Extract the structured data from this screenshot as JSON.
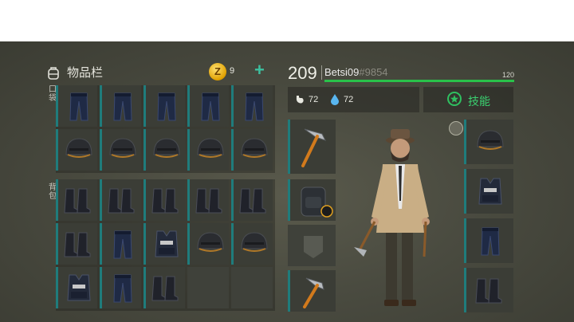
{
  "inventory": {
    "title": "物品栏",
    "coins": "9",
    "add": "+"
  },
  "sections": {
    "pockets": "口袋",
    "backpack": "背包"
  },
  "player": {
    "level": "209",
    "name": "Betsi09",
    "tag": "#9854",
    "xp_max": "120",
    "xp_fraction": 1.0
  },
  "stats": {
    "hunger": "72",
    "thirst": "72"
  },
  "skills": {
    "label": "技能"
  },
  "pocket_slots": [
    "police-pants",
    "police-pants",
    "police-pants",
    "police-pants",
    "police-pants",
    "police-helmet",
    "police-helmet",
    "police-helmet",
    "police-helmet",
    "police-helmet"
  ],
  "backpack_slots": [
    "police-boots",
    "police-boots",
    "police-boots",
    "police-boots",
    "police-boots",
    "police-boots",
    "police-pants",
    "police-vest",
    "police-helmet",
    "police-helmet",
    "police-vest",
    "police-pants",
    "police-boots",
    "",
    ""
  ],
  "equipment": {
    "weapon": "pickaxe",
    "backpack": "tactical-backpack",
    "pocket": "empty-pocket",
    "tool": "pickaxe"
  },
  "gear": [
    "police-helmet",
    "police-vest",
    "police-pants",
    "police-boots"
  ],
  "colors": {
    "slot_accent": "#1f7c7c",
    "xp": "#29c24a",
    "skill": "#3ad070",
    "plus": "#3cc0a0"
  }
}
